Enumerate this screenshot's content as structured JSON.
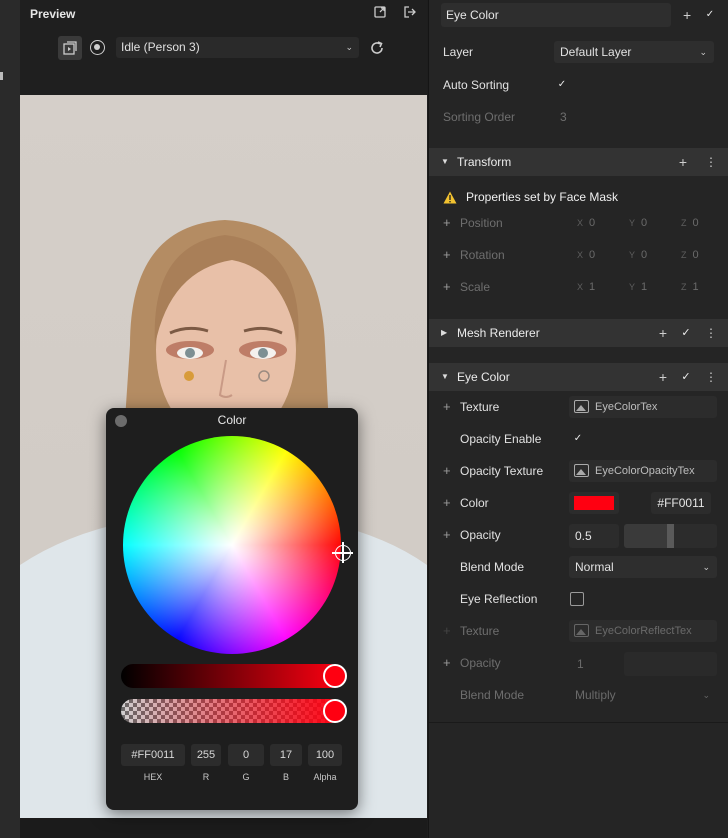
{
  "preview": {
    "title": "Preview",
    "animation_select": "Idle (Person 3)"
  },
  "color_picker": {
    "title": "Color",
    "hex": "#FF0011",
    "r": "255",
    "g": "0",
    "b": "17",
    "alpha": "100",
    "labels": {
      "hex": "HEX",
      "r": "R",
      "g": "G",
      "b": "B",
      "alpha": "Alpha"
    },
    "current_color": "#FF0011"
  },
  "inspector": {
    "component_name": "Eye Color",
    "layer_label": "Layer",
    "layer_value": "Default Layer",
    "auto_sorting_label": "Auto Sorting",
    "sorting_order_label": "Sorting Order",
    "sorting_order_value": "3",
    "transform": {
      "title": "Transform",
      "warning": "Properties set by Face Mask",
      "position_label": "Position",
      "rotation_label": "Rotation",
      "scale_label": "Scale",
      "axis_x": "X",
      "axis_y": "Y",
      "axis_z": "Z",
      "position": [
        "0",
        "0",
        "0"
      ],
      "rotation": [
        "0",
        "0",
        "0"
      ],
      "scale": [
        "1",
        "1",
        "1"
      ]
    },
    "mesh_renderer": {
      "title": "Mesh Renderer"
    },
    "eye_color": {
      "title": "Eye Color",
      "texture_label": "Texture",
      "texture_value": "EyeColorTex",
      "opacity_enable_label": "Opacity Enable",
      "opacity_texture_label": "Opacity Texture",
      "opacity_texture_value": "EyeColorOpacityTex",
      "color_label": "Color",
      "color_hex": "#FF0011",
      "color_swatch": "#FF0011",
      "opacity_label": "Opacity",
      "opacity_value": "0.5",
      "blend_mode_label": "Blend Mode",
      "blend_mode_value": "Normal",
      "eye_reflection_label": "Eye Reflection",
      "reflect_texture_label": "Texture",
      "reflect_texture_value": "EyeColorReflectTex",
      "reflect_opacity_label": "Opacity",
      "reflect_opacity_value": "1",
      "reflect_blend_label": "Blend Mode",
      "reflect_blend_value": "Multiply"
    }
  }
}
